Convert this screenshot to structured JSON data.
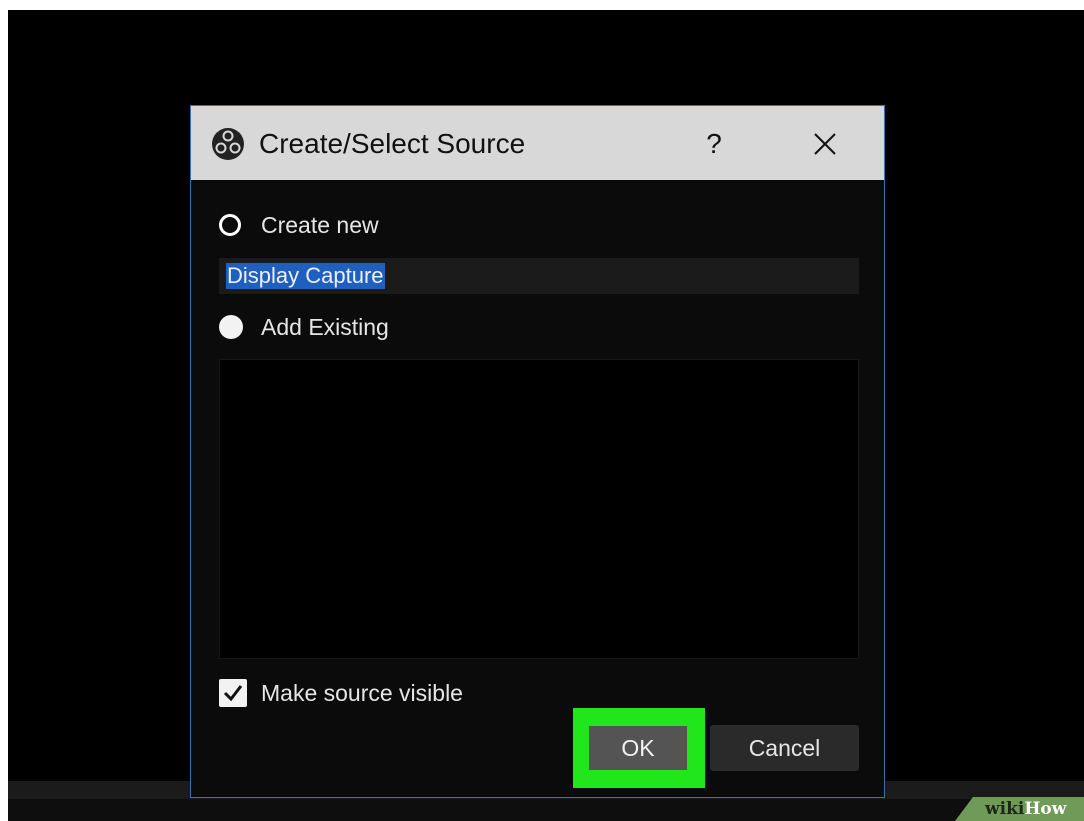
{
  "dialog": {
    "title": "Create/Select Source",
    "help_label": "?",
    "close_icon": "close-icon",
    "app_icon": "obs-logo-icon"
  },
  "create_new": {
    "label": "Create new",
    "selected": false
  },
  "source_name": {
    "value": "Display Capture",
    "selected_text": true
  },
  "add_existing": {
    "label": "Add Existing",
    "selected": true
  },
  "existing_sources": [],
  "visibility": {
    "label": "Make source visible",
    "checked": true
  },
  "buttons": {
    "ok": "OK",
    "cancel": "Cancel"
  },
  "colors": {
    "highlight": "#22e61c",
    "selection": "#1f5fbf",
    "accent_border": "#3a6fb0"
  },
  "watermark": {
    "part1": "wiki",
    "part2": "How"
  }
}
